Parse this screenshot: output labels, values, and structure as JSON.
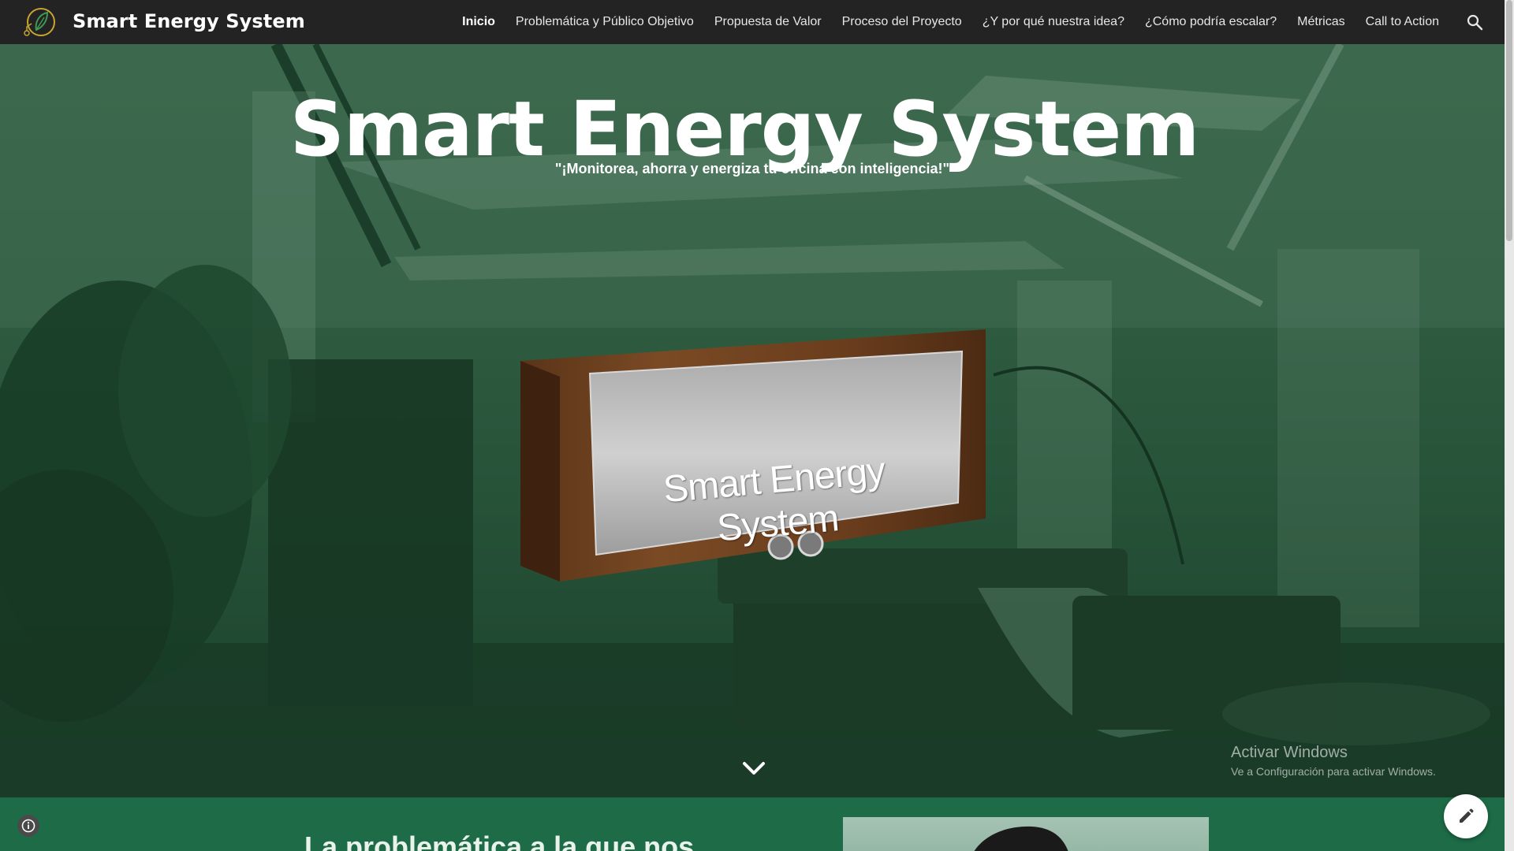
{
  "header": {
    "site_title": "Smart Energy System",
    "logo_icon": "leaf-bulb-logo-icon",
    "nav": [
      {
        "label": "Inicio",
        "active": true
      },
      {
        "label": "Problemática y Público Objetivo",
        "active": false
      },
      {
        "label": "Propuesta de Valor",
        "active": false
      },
      {
        "label": "Proceso del Proyecto",
        "active": false
      },
      {
        "label": "¿Y por qué nuestra idea?",
        "active": false
      },
      {
        "label": "¿Cómo podría escalar?",
        "active": false
      },
      {
        "label": "Métricas",
        "active": false
      },
      {
        "label": "Call to Action",
        "active": false
      }
    ],
    "search_icon": "search-icon"
  },
  "hero": {
    "title": "Smart Energy System",
    "subtitle": "\"¡Monitorea, ahorra y energiza tu oficina con inteligencia!\"",
    "sign_text": "Smart Energy System",
    "scroll_icon": "chevron-down-icon"
  },
  "watermark": {
    "title": "Activar Windows",
    "subtitle": "Ve a Configuración para activar Windows."
  },
  "section2": {
    "heading": "La problemática a la que nos"
  },
  "floating": {
    "info_icon": "info-icon",
    "edit_icon": "pencil-icon"
  },
  "colors": {
    "topbar": "#232323",
    "hero_tint": "#2f5a40",
    "section_green": "#1d6c47",
    "logo_accent": "#c8a530"
  }
}
